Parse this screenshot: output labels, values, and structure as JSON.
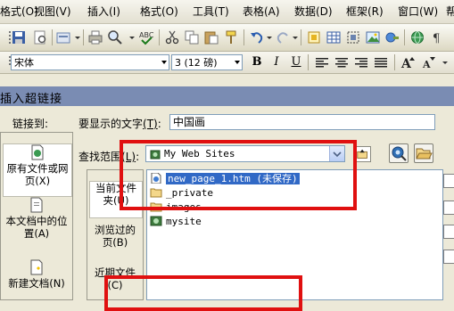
{
  "menubar": {
    "items": [
      "格式(O)",
      "视图(V)",
      "插入(I)",
      "格式(O)",
      "工具(T)",
      "表格(A)",
      "数据(D)",
      "框架(R)",
      "窗口(W)",
      "帮"
    ]
  },
  "formatbar": {
    "font_name": "宋体",
    "font_size": "3 (12 磅)",
    "bold": "B",
    "italic": "I",
    "underline": "U"
  },
  "dialog": {
    "title": "插入超链接",
    "link_to_label": "链接到:",
    "text_to_display_label": "要显示的文字",
    "text_to_display_key": "(T)",
    "text_to_display_colon": ":",
    "text_to_display_value": "中国画",
    "look_in_label": "查找范围",
    "look_in_key": "(L)",
    "look_in_colon": ":",
    "look_in_value": "My Web Sites",
    "places": [
      {
        "line1": "原有文件或网",
        "line2": "页(X)"
      },
      {
        "line1": "本文档中的位",
        "line2": "置(A)"
      },
      {
        "line1": "新建文档(N)",
        "line2": ""
      }
    ],
    "look_tabs": [
      {
        "line1": "当前文件",
        "line2": "夹(U)"
      },
      {
        "line1": "浏览过的",
        "line2": "页(B)"
      },
      {
        "line1": "近期文件",
        "line2": "(C)"
      }
    ],
    "files": [
      {
        "name": "new_page_1.htm (未保存)",
        "icon": "html-page-icon",
        "selected": true
      },
      {
        "name": "_private",
        "icon": "folder-icon",
        "selected": false
      },
      {
        "name": "images",
        "icon": "folder-icon",
        "selected": false
      },
      {
        "name": "mysite",
        "icon": "web-site-icon",
        "selected": false
      }
    ]
  },
  "colors": {
    "annotation_red": "#e01010",
    "selection_blue": "#3169c6",
    "dialog_title_bar": "#7a8cb3"
  }
}
